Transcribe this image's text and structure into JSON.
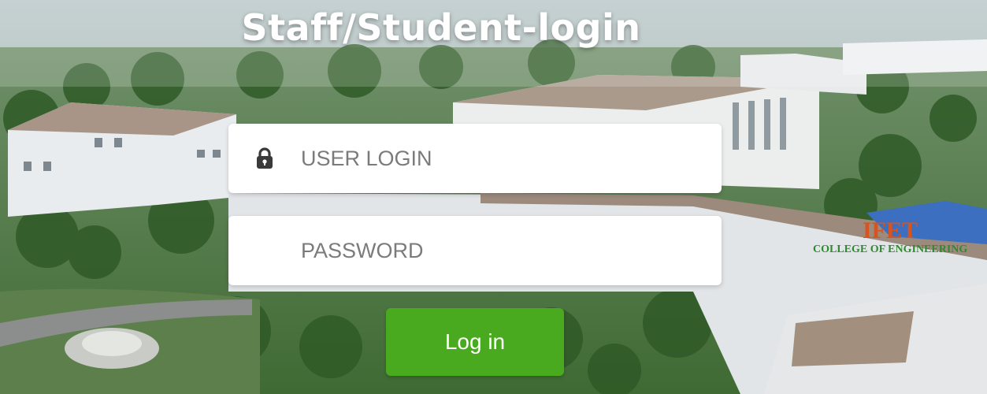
{
  "page": {
    "title": "Staff/Student-login"
  },
  "form": {
    "username_placeholder": "USER LOGIN",
    "username_value": "",
    "password_placeholder": "PASSWORD",
    "password_value": "",
    "submit_label": "Log in"
  },
  "background": {
    "sign_top": "IFET",
    "sign_bottom": "COLLEGE OF ENGINEERING"
  },
  "colors": {
    "accent": "#4aaa1f",
    "field_bg": "#ffffff",
    "placeholder": "#7b7b7b",
    "heading": "#ffffff"
  },
  "icons": {
    "username_icon": "lock-icon"
  }
}
